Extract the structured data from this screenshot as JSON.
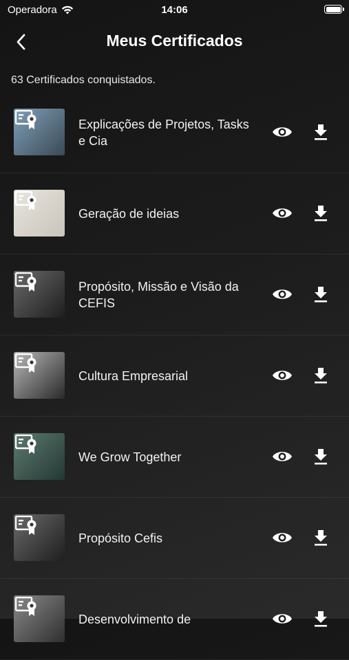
{
  "status_bar": {
    "carrier": "Operadora",
    "time": "14:06",
    "battery_level": 1.0
  },
  "header": {
    "title": "Meus Certificados",
    "back_icon": "chevron-left-icon"
  },
  "summary": {
    "text": "63 Certificados conquistados."
  },
  "certificates": [
    {
      "title": "Explicações de Projetos, Tasks e Cia",
      "thumb_colors": [
        "#7fa0b8",
        "#3b4a55"
      ]
    },
    {
      "title": "Geração de ideias",
      "thumb_colors": [
        "#e8e5df",
        "#c9c4bb"
      ]
    },
    {
      "title": "Propósito, Missão e Visão da CEFIS",
      "thumb_colors": [
        "#6a6a6a",
        "#1e1e1e"
      ]
    },
    {
      "title": "Cultura Empresarial",
      "thumb_colors": [
        "#b8b8b8",
        "#2a2a2a"
      ]
    },
    {
      "title": "We Grow Together",
      "thumb_colors": [
        "#5d7a70",
        "#243833"
      ]
    },
    {
      "title": "Propósito Cefis",
      "thumb_colors": [
        "#6a6a6a",
        "#1e1e1e"
      ]
    },
    {
      "title": "Desenvolvimento de",
      "thumb_colors": [
        "#8a8a8a",
        "#2f2f2f"
      ]
    }
  ],
  "icons": {
    "view": "eye-icon",
    "download": "download-icon",
    "badge": "certificate-badge-icon"
  },
  "colors": {
    "background": "#1c1c1c",
    "text": "#ffffff"
  }
}
